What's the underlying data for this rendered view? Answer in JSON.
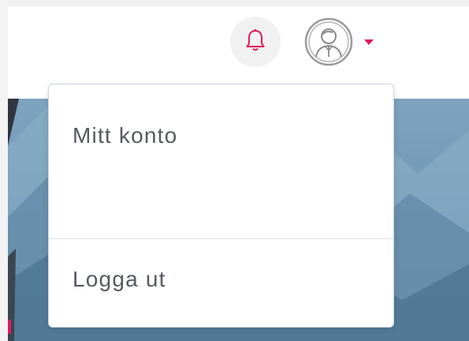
{
  "header": {
    "notifications": {
      "icon": "bell-icon"
    },
    "user": {
      "icon": "user-avatar-icon",
      "toggle_icon": "caret-down-icon"
    }
  },
  "dropdown": {
    "items": [
      {
        "label": "Mitt konto"
      },
      {
        "label": "Logga ut"
      }
    ]
  },
  "colors": {
    "accent": "#e0195f",
    "menu_text": "#555a60",
    "hero_sky": "#7ea3bf"
  }
}
